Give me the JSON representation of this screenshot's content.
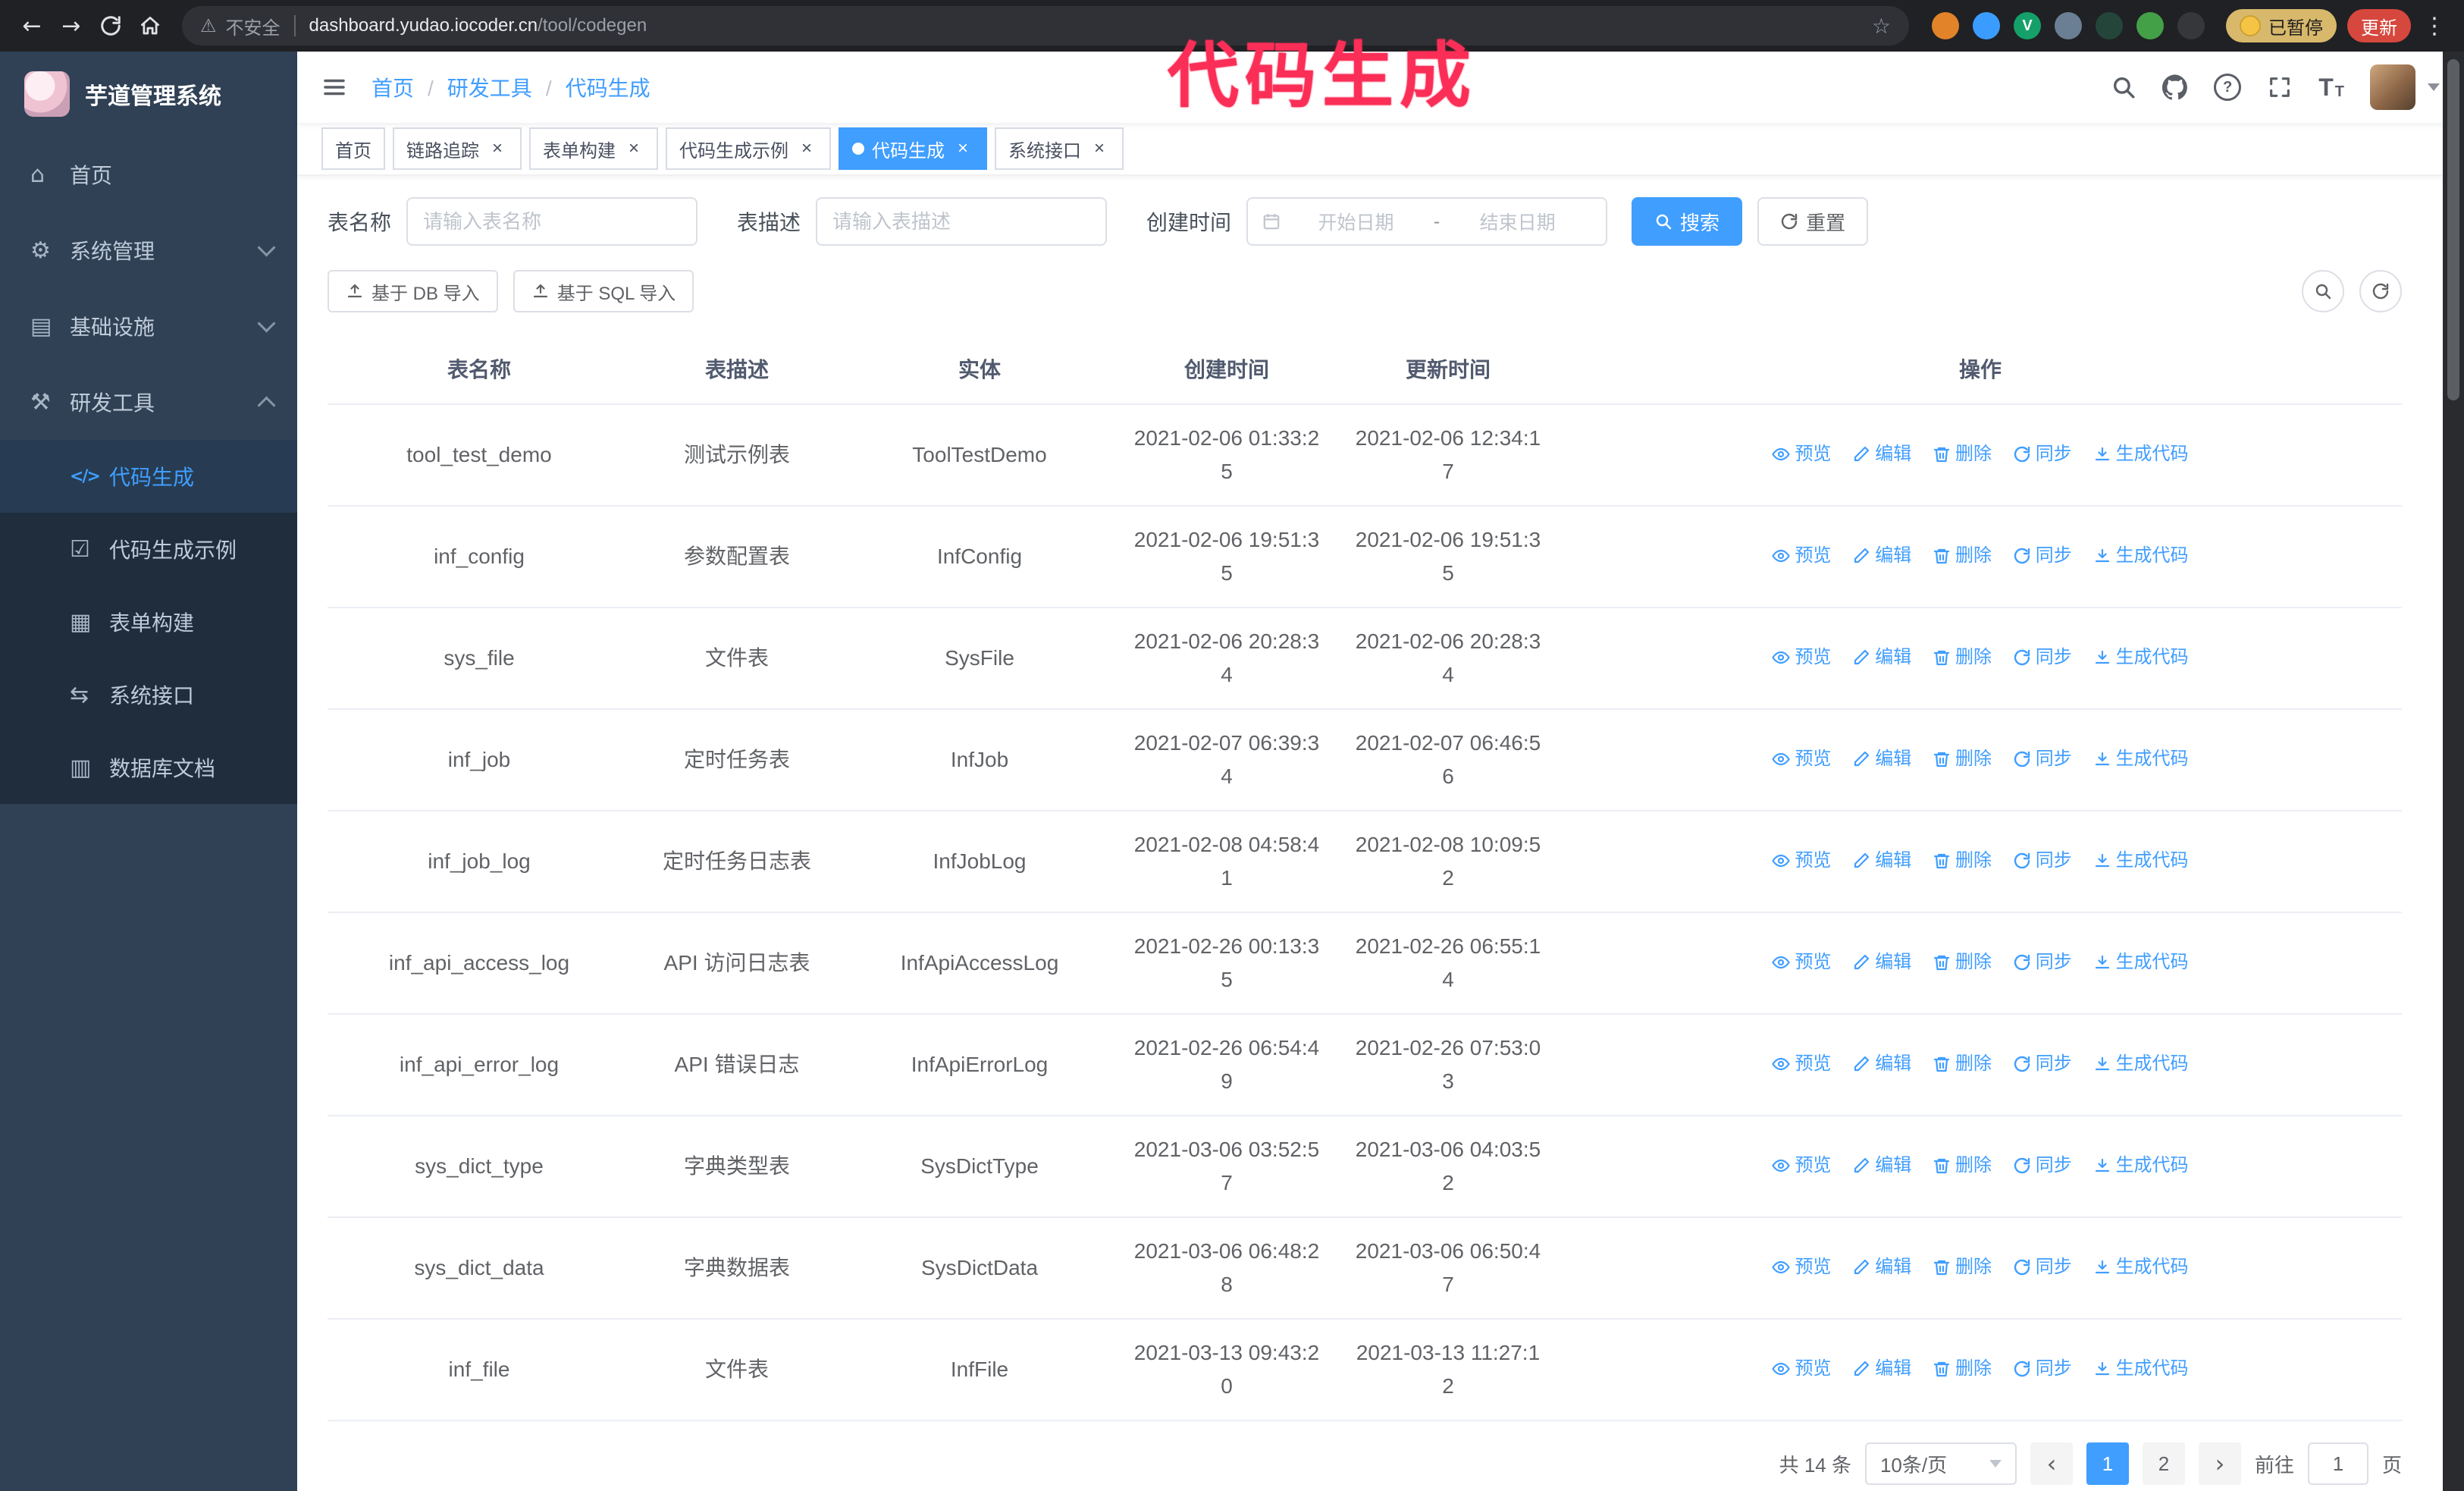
{
  "theme": {
    "accent": "#409eff",
    "sidebar_bg": "#304156",
    "submenu_bg": "#1f2d3d",
    "chrome_bg": "#202124",
    "annotation_color": "#fb2e57"
  },
  "annotation": {
    "text": "代码生成"
  },
  "browser": {
    "security_label": "不安全",
    "url_host": "dashboard.yudao.iocoder.cn",
    "url_path": "/tool/codegen",
    "paused_badge": "已暂停",
    "update_button": "更新",
    "extensions": [
      {
        "color": "#e2832a"
      },
      {
        "color": "#3b9cff"
      },
      {
        "color": "#15a06a",
        "glyph": "V"
      },
      {
        "color": "#6b7f94"
      },
      {
        "color": "#24463a"
      },
      {
        "color": "#43a047"
      },
      {
        "color": "#35373b"
      }
    ]
  },
  "sidebar": {
    "title": "芋道管理系统",
    "items": [
      {
        "label": "首页",
        "icon": "home"
      },
      {
        "label": "系统管理",
        "icon": "gear",
        "chevron": "down"
      },
      {
        "label": "基础设施",
        "icon": "infra",
        "chevron": "down"
      },
      {
        "label": "研发工具",
        "icon": "tools",
        "chevron": "up",
        "children": [
          {
            "label": "代码生成",
            "icon": "code",
            "active": true
          },
          {
            "label": "代码生成示例",
            "icon": "example"
          },
          {
            "label": "表单构建",
            "icon": "form"
          },
          {
            "label": "系统接口",
            "icon": "api"
          },
          {
            "label": "数据库文档",
            "icon": "db"
          }
        ]
      }
    ]
  },
  "header": {
    "breadcrumb": [
      "首页",
      "研发工具",
      "代码生成"
    ]
  },
  "tabs": [
    {
      "label": "首页",
      "closable": false
    },
    {
      "label": "链路追踪",
      "closable": true
    },
    {
      "label": "表单构建",
      "closable": true
    },
    {
      "label": "代码生成示例",
      "closable": true
    },
    {
      "label": "代码生成",
      "closable": true,
      "active": true
    },
    {
      "label": "系统接口",
      "closable": true
    }
  ],
  "filters": {
    "table_name_label": "表名称",
    "table_name_placeholder": "请输入表名称",
    "table_desc_label": "表描述",
    "table_desc_placeholder": "请输入表描述",
    "create_time_label": "创建时间",
    "date_start_placeholder": "开始日期",
    "date_separator": "-",
    "date_end_placeholder": "结束日期",
    "search_button": "搜索",
    "reset_button": "重置"
  },
  "toolbar": {
    "import_db": "基于 DB 导入",
    "import_sql": "基于 SQL 导入"
  },
  "table": {
    "columns": [
      "表名称",
      "表描述",
      "实体",
      "创建时间",
      "更新时间",
      "操作"
    ],
    "actions": [
      "预览",
      "编辑",
      "删除",
      "同步",
      "生成代码"
    ],
    "rows": [
      {
        "name": "tool_test_demo",
        "desc": "测试示例表",
        "entity": "ToolTestDemo",
        "created": "2021-02-06 01:33:25",
        "updated": "2021-02-06 12:34:17"
      },
      {
        "name": "inf_config",
        "desc": "参数配置表",
        "entity": "InfConfig",
        "created": "2021-02-06 19:51:35",
        "updated": "2021-02-06 19:51:35"
      },
      {
        "name": "sys_file",
        "desc": "文件表",
        "entity": "SysFile",
        "created": "2021-02-06 20:28:34",
        "updated": "2021-02-06 20:28:34"
      },
      {
        "name": "inf_job",
        "desc": "定时任务表",
        "entity": "InfJob",
        "created": "2021-02-07 06:39:34",
        "updated": "2021-02-07 06:46:56"
      },
      {
        "name": "inf_job_log",
        "desc": "定时任务日志表",
        "entity": "InfJobLog",
        "created": "2021-02-08 04:58:41",
        "updated": "2021-02-08 10:09:52"
      },
      {
        "name": "inf_api_access_log",
        "desc": "API 访问日志表",
        "entity": "InfApiAccessLog",
        "created": "2021-02-26 00:13:35",
        "updated": "2021-02-26 06:55:14"
      },
      {
        "name": "inf_api_error_log",
        "desc": "API 错误日志",
        "entity": "InfApiErrorLog",
        "created": "2021-02-26 06:54:49",
        "updated": "2021-02-26 07:53:03"
      },
      {
        "name": "sys_dict_type",
        "desc": "字典类型表",
        "entity": "SysDictType",
        "created": "2021-03-06 03:52:57",
        "updated": "2021-03-06 04:03:52"
      },
      {
        "name": "sys_dict_data",
        "desc": "字典数据表",
        "entity": "SysDictData",
        "created": "2021-03-06 06:48:28",
        "updated": "2021-03-06 06:50:47"
      },
      {
        "name": "inf_file",
        "desc": "文件表",
        "entity": "InfFile",
        "created": "2021-03-13 09:43:20",
        "updated": "2021-03-13 11:27:12"
      }
    ]
  },
  "pagination": {
    "total": "共 14 条",
    "page_size": "10条/页",
    "pages": [
      "1",
      "2"
    ],
    "active_page": "1",
    "goto_label": "前往",
    "goto_value": "1",
    "goto_suffix": "页"
  }
}
